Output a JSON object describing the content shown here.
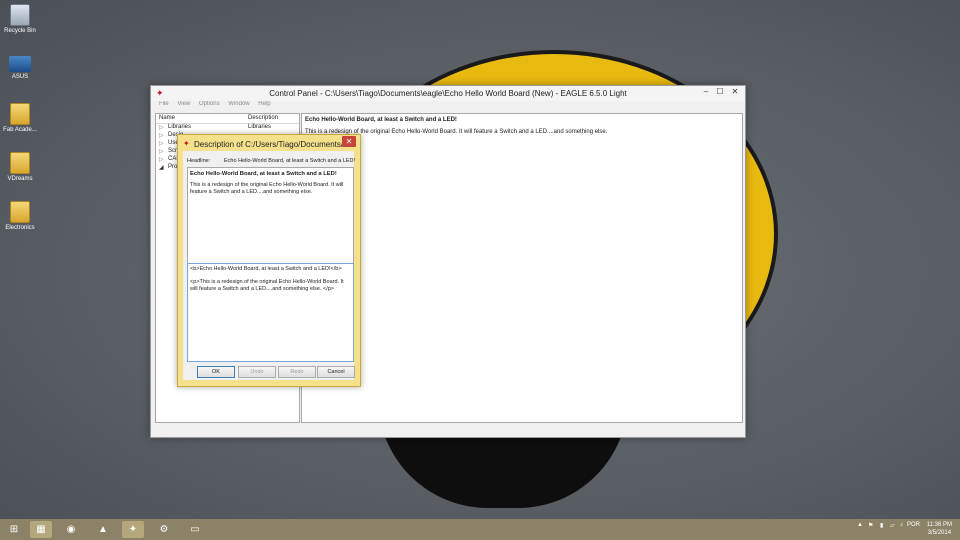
{
  "desktop": {
    "icons": [
      {
        "label": "Recycle Bin",
        "icon": "recycle-bin-icon"
      },
      {
        "label": "ASUS",
        "icon": "asus-icon"
      },
      {
        "label": "Fab Acade...",
        "icon": "folder-icon"
      },
      {
        "label": "VDreams",
        "icon": "folder-icon"
      },
      {
        "label": "Electronics",
        "icon": "folder-icon"
      }
    ]
  },
  "window": {
    "title": "Control Panel - C:\\Users\\Tiago\\Documents\\eagle\\Echo Hello World Board (New) - EAGLE 6.5.0 Light",
    "controls": {
      "minimize": "–",
      "maximize": "☐",
      "close": "✕"
    },
    "menu": [
      "File",
      "View",
      "Options",
      "Window",
      "Help"
    ],
    "tree": {
      "columns": [
        "Name",
        "Description"
      ],
      "rows": [
        {
          "name": "Libraries",
          "desc": "Libraries"
        },
        {
          "name": "Desig",
          "desc": ""
        },
        {
          "name": "User",
          "desc": ""
        },
        {
          "name": "Scrip",
          "desc": ""
        },
        {
          "name": "CAM",
          "desc": ""
        },
        {
          "name": "Proj",
          "desc": ""
        }
      ]
    },
    "info": {
      "heading": "Echo Hello-World Board, at least a Switch and a LED!",
      "text": "This is a redesign of the original Echo Hello-World Board. It will feature a Switch and a LED....and something else."
    }
  },
  "dialog": {
    "title": "Description of C:/Users/Tiago/Documents/...",
    "headline_label": "Headline:",
    "headline_value": "Echo Hello-World Board, at least a Switch and a LED!",
    "preview_heading": "Echo Hello-World Board, at least a Switch and a LED!",
    "preview_text": "This is a redesign of the original Echo Hello-World Board. It will feature a Switch and a LED....and something else.",
    "source_line1": "<b>Echo Hello-World Board, at least a Switch and a LED!</b>",
    "source_line2": "<p>This is a redesign of the original Echo Hello-World Board. It will feature a Switch and a LED....and something else. </p>",
    "buttons": {
      "ok": "OK",
      "undo": "Undo",
      "redo": "Redo",
      "cancel": "Cancel"
    }
  },
  "taskbar": {
    "lang": "POR",
    "time": "11:36 PM",
    "date": "3/5/2014",
    "colors": {
      "taskbar": "#8c8268"
    }
  }
}
